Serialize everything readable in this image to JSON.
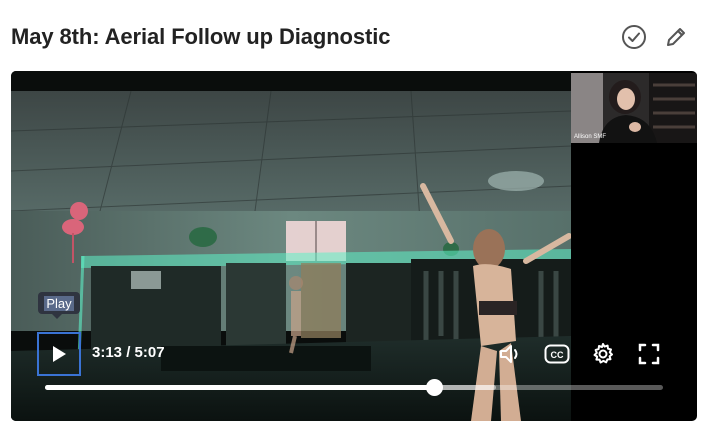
{
  "header": {
    "title": "May 8th: Aerial Follow up Diagnostic",
    "check_icon": "check-circle-icon",
    "edit_icon": "pencil-icon"
  },
  "player": {
    "tooltip": "Play",
    "time_display": "3:13 / 5:07",
    "current_time": "3:13",
    "duration": "5:07",
    "progress_fraction": 0.629,
    "buffered_fraction": 0.73,
    "pip_name": "Allison SMF",
    "icons": {
      "play": "play-icon",
      "volume": "volume-icon",
      "captions": "closed-captions-icon",
      "settings": "gear-icon",
      "fullscreen": "fullscreen-icon"
    }
  },
  "colors": {
    "focus_outline": "#3a73d4",
    "tooltip_bg": "#2f3440",
    "title_text": "#222222"
  }
}
